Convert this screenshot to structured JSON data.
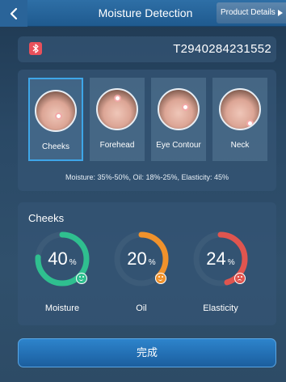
{
  "header": {
    "title": "Moisture Detection",
    "details_label": "Product Details"
  },
  "device": {
    "serial": "T2940284231552",
    "connection_icon": "bluetooth-icon"
  },
  "areas": [
    {
      "label": "Cheeks",
      "selected": true
    },
    {
      "label": "Forehead",
      "selected": false
    },
    {
      "label": "Eye Contour",
      "selected": false
    },
    {
      "label": "Neck",
      "selected": false
    }
  ],
  "ranges_text": "Moisture: 35%-50%, Oil: 18%-25%, Elasticity: 45%",
  "results": {
    "title": "Cheeks",
    "metrics": [
      {
        "label": "Moisture",
        "value": "40",
        "unit": "%",
        "level": 0.4,
        "color": "#2fbf8f",
        "mood": "happy"
      },
      {
        "label": "Oil",
        "value": "20",
        "unit": "%",
        "level": 0.2,
        "color": "#f0922c",
        "mood": "happy"
      },
      {
        "label": "Elasticity",
        "value": "24",
        "unit": "%",
        "level": 0.24,
        "color": "#e0554f",
        "mood": "sad"
      }
    ]
  },
  "footer": {
    "finish_label": "完成"
  }
}
